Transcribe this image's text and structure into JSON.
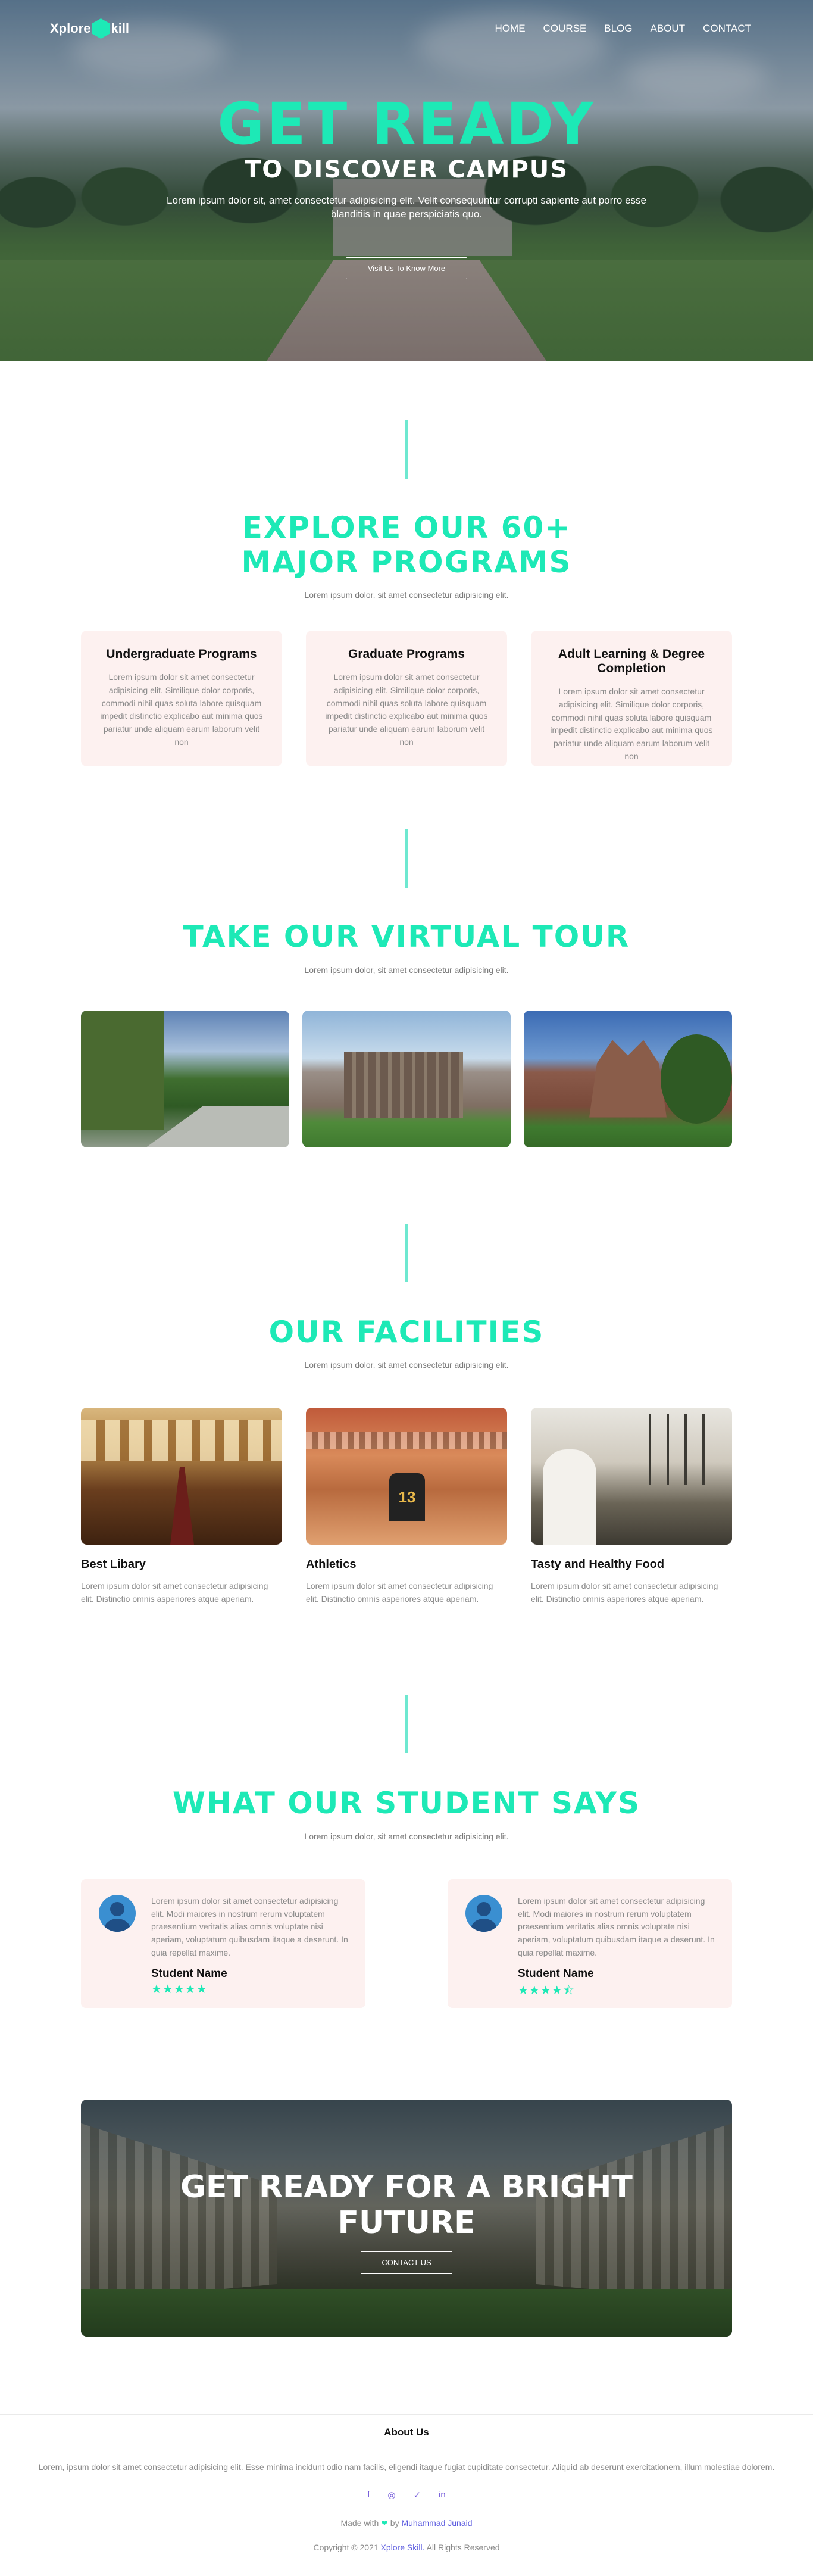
{
  "brand": {
    "part1": "Xplore",
    "part2": "kill"
  },
  "nav": [
    "HOME",
    "COURSE",
    "BLOG",
    "ABOUT",
    "CONTACT"
  ],
  "hero": {
    "title": "GET READY",
    "subtitle": "TO DISCOVER CAMPUS",
    "text": "Lorem ipsum dolor sit, amet consectetur adipisicing elit. Velit consequuntur corrupti sapiente aut porro esse blanditiis in quae perspiciatis quo.",
    "button": "Visit Us To Know More"
  },
  "programs": {
    "title_line1": "EXPLORE OUR 60+",
    "title_line2": "MAJOR PROGRAMS",
    "subtitle": "Lorem ipsum dolor, sit amet consectetur adipisicing elit.",
    "cards": [
      {
        "title": "Undergraduate Programs",
        "text": "Lorem ipsum dolor sit amet consectetur adipisicing elit. Similique dolor corporis, commodi nihil quas soluta labore quisquam impedit distinctio explicabo aut minima quos pariatur unde aliquam earum laborum velit non"
      },
      {
        "title": "Graduate Programs",
        "text": "Lorem ipsum dolor sit amet consectetur adipisicing elit. Similique dolor corporis, commodi nihil quas soluta labore quisquam impedit distinctio explicabo aut minima quos pariatur unde aliquam earum laborum velit non"
      },
      {
        "title": "Adult Learning & Degree Completion",
        "text": "Lorem ipsum dolor sit amet consectetur adipisicing elit. Similique dolor corporis, commodi nihil quas soluta labore quisquam impedit distinctio explicabo aut minima quos pariatur unde aliquam earum laborum velit non"
      }
    ]
  },
  "tour": {
    "title": "TAKE OUR VIRTUAL TOUR",
    "subtitle": "Lorem ipsum dolor, sit amet consectetur adipisicing elit."
  },
  "facilities": {
    "title": "OUR FACILITIES",
    "subtitle": "Lorem ipsum dolor, sit amet consectetur adipisicing elit.",
    "items": [
      {
        "title": "Best Libary",
        "text": "Lorem ipsum dolor sit amet consectetur adipisicing elit. Distinctio omnis asperiores atque aperiam."
      },
      {
        "title": "Athletics",
        "text": "Lorem ipsum dolor sit amet consectetur adipisicing elit. Distinctio omnis asperiores atque aperiam."
      },
      {
        "title": "Tasty and Healthy Food",
        "text": "Lorem ipsum dolor sit amet consectetur adipisicing elit. Distinctio omnis asperiores atque aperiam."
      }
    ]
  },
  "testimonials": {
    "title": "WHAT OUR STUDENT SAYS",
    "subtitle": "Lorem ipsum dolor, sit amet consectetur adipisicing elit.",
    "items": [
      {
        "text": "Lorem ipsum dolor sit amet consectetur adipisicing elit. Modi maiores in nostrum rerum voluptatem praesentium veritatis alias omnis voluptate nisi aperiam, voluptatum quibusdam itaque a deserunt. In quia repellat maxime.",
        "name": "Student Name",
        "stars": "★★★★★",
        "rating": 5
      },
      {
        "text": "Lorem ipsum dolor sit amet consectetur adipisicing elit. Modi maiores in nostrum rerum voluptatem praesentium veritatis alias omnis voluptate nisi aperiam, voluptatum quibusdam itaque a deserunt. In quia repellat maxime.",
        "name": "Student Name",
        "stars": "★★★★⯪",
        "rating": 4.5
      }
    ]
  },
  "cta": {
    "title_line1": "GET READY FOR A BRIGHT",
    "title_line2": "FUTURE",
    "button": "CONTACT US"
  },
  "footer": {
    "heading": "About Us",
    "about": "Lorem, ipsum dolor sit amet consectetur adipisicing elit. Esse minima incidunt odio nam facilis, eligendi itaque fugiat cupiditate consectetur. Aliquid ab deserunt exercitationem, illum molestiae dolorem.",
    "socials": [
      "f",
      "◎",
      "✓",
      "in"
    ],
    "made_prefix": "Made with",
    "made_heart": "❤",
    "made_by": "by",
    "made_author": "Muhammad Junaid",
    "copy_prefix": "Copyright © 2021",
    "copy_brand": "Xplore Skill.",
    "copy_suffix": "All Rights Reserved"
  },
  "colors": {
    "accent": "#1de9b6",
    "card_bg": "#fdf1f0",
    "link": "#5a5adf"
  }
}
